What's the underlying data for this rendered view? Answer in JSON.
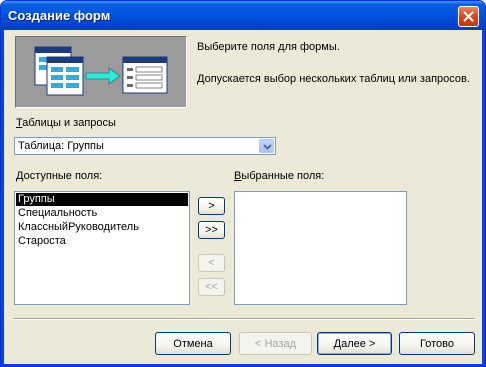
{
  "window": {
    "title": "Создание форм"
  },
  "banner": {
    "line1": "Выберите поля для формы.",
    "line2": "Допускается выбор нескольких таблиц или запросов."
  },
  "tables": {
    "label": "Таблицы и запросы",
    "selected": "Таблица: Группы"
  },
  "available": {
    "label": "Доступные поля:",
    "items": [
      "Группы",
      "Специальность",
      "КлассныйРуководитель",
      "Староста"
    ]
  },
  "selected_fields": {
    "label": "Выбранные поля:",
    "items": []
  },
  "move": {
    "add_one": ">",
    "add_all": ">>",
    "remove_one": "<",
    "remove_all": "<<"
  },
  "footer": {
    "cancel": "Отмена",
    "back": "< Назад",
    "next": "Далее >",
    "finish": "Готово"
  },
  "colors": {
    "titlebar": "#0054e3",
    "dialog_bg": "#ece9d8",
    "selection": "#000000"
  }
}
